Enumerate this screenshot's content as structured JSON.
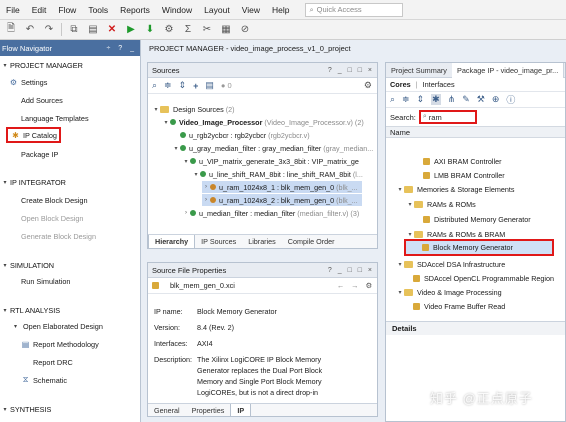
{
  "menubar": {
    "items": [
      "File",
      "Edit",
      "Flow",
      "Tools",
      "Reports",
      "Window",
      "Layout",
      "View",
      "Help"
    ],
    "quick_access_placeholder": "Quick Access"
  },
  "flow_navigator": {
    "title": "Flow Navigator",
    "controls": "÷ ? _",
    "project_manager": {
      "label": "PROJECT MANAGER",
      "items": [
        "Settings",
        "Add Sources",
        "Language Templates",
        "IP Catalog"
      ]
    },
    "ip_integrator": {
      "label": "IP INTEGRATOR",
      "items": [
        "Create Block Design",
        "Open Block Design",
        "Generate Block Design"
      ]
    },
    "simulation": {
      "label": "SIMULATION",
      "items": [
        "Run Simulation"
      ]
    },
    "rtl_analysis": {
      "label": "RTL ANALYSIS",
      "elaborated": "Open Elaborated Design",
      "items": [
        "Report Methodology",
        "Report DRC",
        "Schematic"
      ]
    },
    "synthesis": {
      "label": "SYNTHESIS"
    },
    "package_ip": "Package IP"
  },
  "project_manager_title": "PROJECT MANAGER - video_image_process_v1_0_project",
  "sources": {
    "title": "Sources",
    "controls": "? _ □ □ ×",
    "badge": "0",
    "design_sources": {
      "label": "Design Sources",
      "count": "(2)"
    },
    "rows": [
      {
        "name": "Video_Image_Processor",
        "file": "(Video_Image_Processor.v) (2)"
      },
      {
        "name": "u_rgb2ycbcr : rgb2ycbcr",
        "file": "(rgb2ycbcr.v)"
      },
      {
        "name": "u_gray_median_filter : gray_median_filter",
        "file": "(gray_median..."
      },
      {
        "name": "u_VIP_matrix_generate_3x3_8bit : VIP_matrix_ge",
        "file": ""
      },
      {
        "name": "u_line_shift_RAM_8bit : line_shift_RAM_8bit",
        "file": "(l..."
      },
      {
        "name": "u_ram_1024x8_1 : blk_mem_gen_0",
        "file": "(blk_..."
      },
      {
        "name": "u_ram_1024x8_2 : blk_mem_gen_0",
        "file": "(blk_..."
      },
      {
        "name": "u_median_filter : median_filter",
        "file": "(median_filter.v) (3)"
      }
    ],
    "tabs": [
      "Hierarchy",
      "IP Sources",
      "Libraries",
      "Compile Order"
    ]
  },
  "properties": {
    "title": "Source File Properties",
    "controls": "? _ □ □ ×",
    "file": "blk_mem_gen_0.xci",
    "ip_name_label": "IP name:",
    "ip_name": "Block Memory Generator",
    "version_label": "Version:",
    "version": "8.4 (Rev. 2)",
    "interfaces_label": "Interfaces:",
    "interfaces": "AXI4",
    "description_label": "Description:",
    "description_lines": [
      "The Xilinx LogiCORE IP Block Memory",
      "Generator replaces the Dual Port Block",
      "Memory and Single Port Block Memory",
      "LogiCOREs, but is not a direct drop-in"
    ],
    "tabs": [
      "General",
      "Properties",
      "IP"
    ]
  },
  "catalog": {
    "tabs": [
      "Project Summary",
      "Package IP - video_image_pr..."
    ],
    "subtabs": [
      "Cores",
      "Interfaces"
    ],
    "search_label": "Search:",
    "search_value": "ram",
    "column": "Name",
    "rows": [
      {
        "text": "AXI BRAM Controller",
        "kind": "ip"
      },
      {
        "text": "LMB BRAM Controller",
        "kind": "ip"
      },
      {
        "text": "Memories & Storage Elements",
        "kind": "folder"
      },
      {
        "text": "RAMs & ROMs",
        "kind": "folder"
      },
      {
        "text": "Distributed Memory Generator",
        "kind": "ip"
      },
      {
        "text": "RAMs & ROMs & BRAM",
        "kind": "folder"
      },
      {
        "text": "Block Memory Generator",
        "kind": "ip"
      },
      {
        "text": "SDAccel DSA Infrastructure",
        "kind": "folder"
      },
      {
        "text": "SDAccel OpenCL Programmable Region",
        "kind": "ip"
      },
      {
        "text": "Video & Image Processing",
        "kind": "folder"
      },
      {
        "text": "Video Frame Buffer Read",
        "kind": "ip"
      }
    ],
    "details": "Details"
  },
  "watermark": "知乎 @正点原子",
  "colors": {
    "accent": "#4a6fa0",
    "highlight_box": "#e01818",
    "selection": "#c9daf2"
  }
}
